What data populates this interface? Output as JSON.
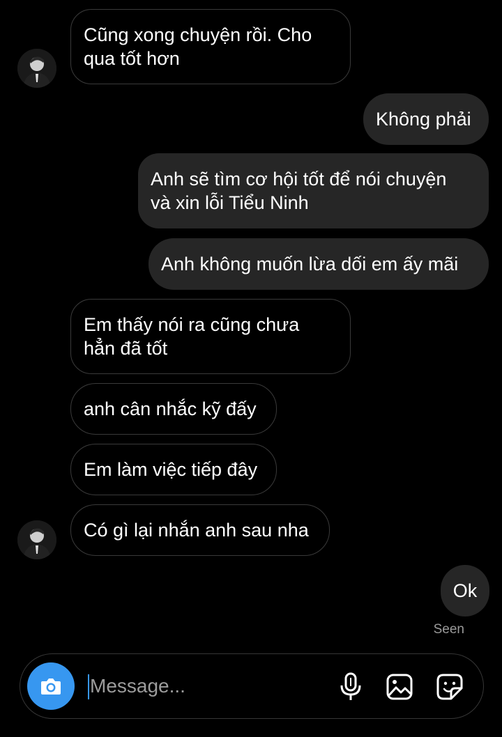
{
  "messages": [
    {
      "lines": [
        "Cũng xong chuyện rồi. Cho",
        "qua tốt hơn"
      ]
    },
    {
      "text": "Không phải"
    },
    {
      "lines": [
        "Anh sẽ tìm cơ hội tốt để nói chuyện",
        "và xin lỗi Tiểu Ninh"
      ]
    },
    {
      "text": "Anh không muốn lừa dối em ấy mãi"
    },
    {
      "lines": [
        "Em thấy nói ra cũng chưa",
        "hẳn đã tốt"
      ]
    },
    {
      "text": "anh cân nhắc kỹ đấy"
    },
    {
      "text": "Em làm việc tiếp đây"
    },
    {
      "text": "Có gì lại nhắn anh sau nha"
    },
    {
      "text": "Ok"
    }
  ],
  "status": {
    "seen": "Seen"
  },
  "composer": {
    "placeholder": "Message..."
  },
  "icons": {
    "camera": "camera-icon",
    "microphone": "microphone-icon",
    "gallery": "image-gallery-icon",
    "sticker": "sticker-icon"
  },
  "colors": {
    "background": "#000000",
    "outgoing_bubble": "#262626",
    "incoming_border": "#3a3a3a",
    "accent": "#3797f0"
  }
}
